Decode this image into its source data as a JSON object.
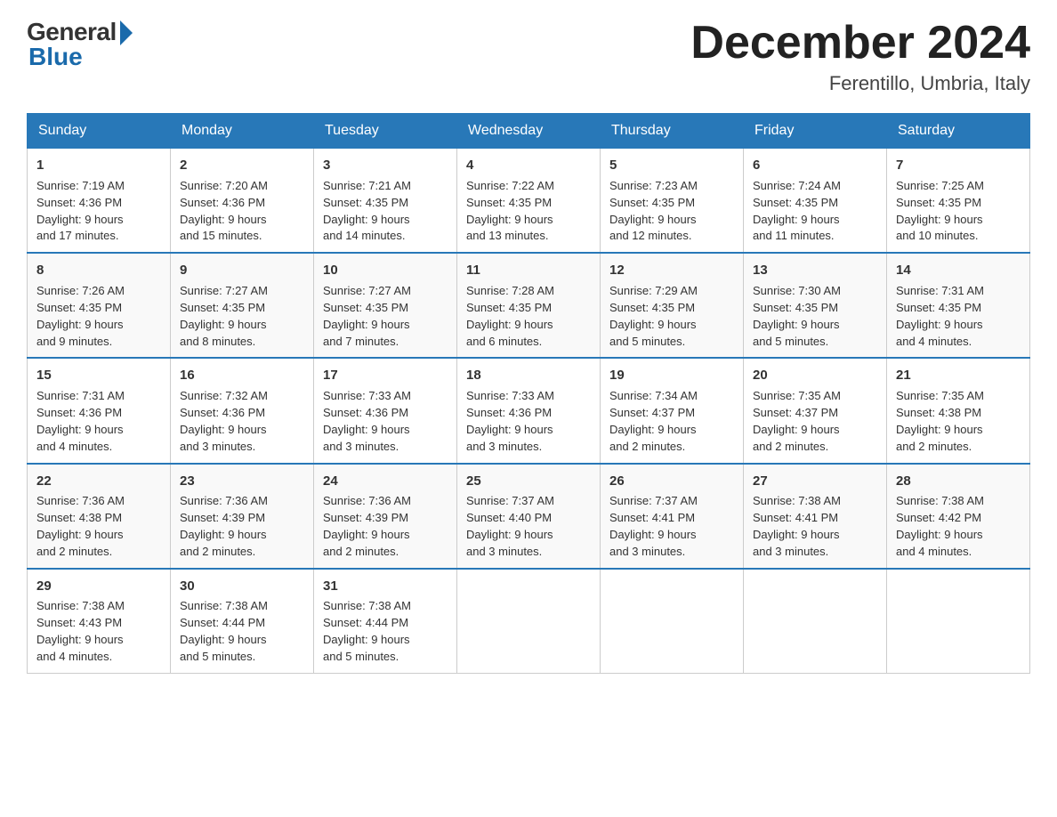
{
  "header": {
    "logo_general": "General",
    "logo_blue": "Blue",
    "title": "December 2024",
    "location": "Ferentillo, Umbria, Italy"
  },
  "weekdays": [
    "Sunday",
    "Monday",
    "Tuesday",
    "Wednesday",
    "Thursday",
    "Friday",
    "Saturday"
  ],
  "weeks": [
    [
      {
        "day": "1",
        "sunrise": "7:19 AM",
        "sunset": "4:36 PM",
        "daylight": "9 hours and 17 minutes."
      },
      {
        "day": "2",
        "sunrise": "7:20 AM",
        "sunset": "4:36 PM",
        "daylight": "9 hours and 15 minutes."
      },
      {
        "day": "3",
        "sunrise": "7:21 AM",
        "sunset": "4:35 PM",
        "daylight": "9 hours and 14 minutes."
      },
      {
        "day": "4",
        "sunrise": "7:22 AM",
        "sunset": "4:35 PM",
        "daylight": "9 hours and 13 minutes."
      },
      {
        "day": "5",
        "sunrise": "7:23 AM",
        "sunset": "4:35 PM",
        "daylight": "9 hours and 12 minutes."
      },
      {
        "day": "6",
        "sunrise": "7:24 AM",
        "sunset": "4:35 PM",
        "daylight": "9 hours and 11 minutes."
      },
      {
        "day": "7",
        "sunrise": "7:25 AM",
        "sunset": "4:35 PM",
        "daylight": "9 hours and 10 minutes."
      }
    ],
    [
      {
        "day": "8",
        "sunrise": "7:26 AM",
        "sunset": "4:35 PM",
        "daylight": "9 hours and 9 minutes."
      },
      {
        "day": "9",
        "sunrise": "7:27 AM",
        "sunset": "4:35 PM",
        "daylight": "9 hours and 8 minutes."
      },
      {
        "day": "10",
        "sunrise": "7:27 AM",
        "sunset": "4:35 PM",
        "daylight": "9 hours and 7 minutes."
      },
      {
        "day": "11",
        "sunrise": "7:28 AM",
        "sunset": "4:35 PM",
        "daylight": "9 hours and 6 minutes."
      },
      {
        "day": "12",
        "sunrise": "7:29 AM",
        "sunset": "4:35 PM",
        "daylight": "9 hours and 5 minutes."
      },
      {
        "day": "13",
        "sunrise": "7:30 AM",
        "sunset": "4:35 PM",
        "daylight": "9 hours and 5 minutes."
      },
      {
        "day": "14",
        "sunrise": "7:31 AM",
        "sunset": "4:35 PM",
        "daylight": "9 hours and 4 minutes."
      }
    ],
    [
      {
        "day": "15",
        "sunrise": "7:31 AM",
        "sunset": "4:36 PM",
        "daylight": "9 hours and 4 minutes."
      },
      {
        "day": "16",
        "sunrise": "7:32 AM",
        "sunset": "4:36 PM",
        "daylight": "9 hours and 3 minutes."
      },
      {
        "day": "17",
        "sunrise": "7:33 AM",
        "sunset": "4:36 PM",
        "daylight": "9 hours and 3 minutes."
      },
      {
        "day": "18",
        "sunrise": "7:33 AM",
        "sunset": "4:36 PM",
        "daylight": "9 hours and 3 minutes."
      },
      {
        "day": "19",
        "sunrise": "7:34 AM",
        "sunset": "4:37 PM",
        "daylight": "9 hours and 2 minutes."
      },
      {
        "day": "20",
        "sunrise": "7:35 AM",
        "sunset": "4:37 PM",
        "daylight": "9 hours and 2 minutes."
      },
      {
        "day": "21",
        "sunrise": "7:35 AM",
        "sunset": "4:38 PM",
        "daylight": "9 hours and 2 minutes."
      }
    ],
    [
      {
        "day": "22",
        "sunrise": "7:36 AM",
        "sunset": "4:38 PM",
        "daylight": "9 hours and 2 minutes."
      },
      {
        "day": "23",
        "sunrise": "7:36 AM",
        "sunset": "4:39 PM",
        "daylight": "9 hours and 2 minutes."
      },
      {
        "day": "24",
        "sunrise": "7:36 AM",
        "sunset": "4:39 PM",
        "daylight": "9 hours and 2 minutes."
      },
      {
        "day": "25",
        "sunrise": "7:37 AM",
        "sunset": "4:40 PM",
        "daylight": "9 hours and 3 minutes."
      },
      {
        "day": "26",
        "sunrise": "7:37 AM",
        "sunset": "4:41 PM",
        "daylight": "9 hours and 3 minutes."
      },
      {
        "day": "27",
        "sunrise": "7:38 AM",
        "sunset": "4:41 PM",
        "daylight": "9 hours and 3 minutes."
      },
      {
        "day": "28",
        "sunrise": "7:38 AM",
        "sunset": "4:42 PM",
        "daylight": "9 hours and 4 minutes."
      }
    ],
    [
      {
        "day": "29",
        "sunrise": "7:38 AM",
        "sunset": "4:43 PM",
        "daylight": "9 hours and 4 minutes."
      },
      {
        "day": "30",
        "sunrise": "7:38 AM",
        "sunset": "4:44 PM",
        "daylight": "9 hours and 5 minutes."
      },
      {
        "day": "31",
        "sunrise": "7:38 AM",
        "sunset": "4:44 PM",
        "daylight": "9 hours and 5 minutes."
      },
      null,
      null,
      null,
      null
    ]
  ],
  "labels": {
    "sunrise": "Sunrise:",
    "sunset": "Sunset:",
    "daylight": "Daylight:"
  }
}
